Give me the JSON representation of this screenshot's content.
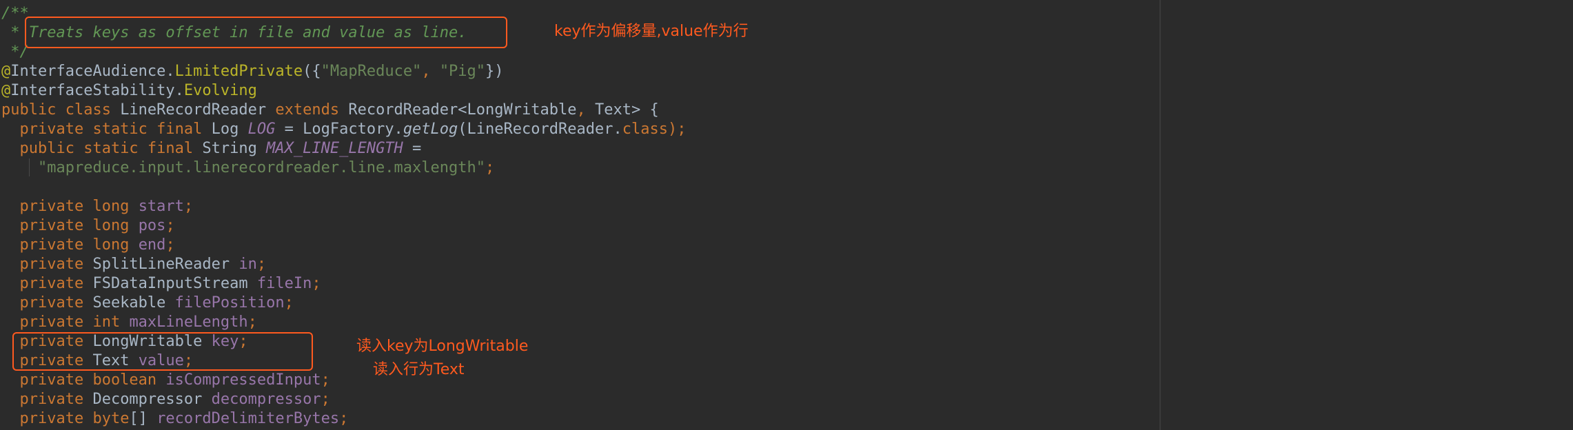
{
  "code_lines": [
    {
      "tokens": [
        {
          "text": "/**",
          "type": "comment"
        }
      ]
    },
    {
      "tokens": [
        {
          "text": " * ",
          "type": "comment"
        },
        {
          "text": "Treats keys as offset in file and value as line.",
          "type": "comment"
        }
      ]
    },
    {
      "tokens": [
        {
          "text": " */",
          "type": "comment"
        }
      ]
    },
    {
      "tokens": [
        {
          "text": "@",
          "type": "ann"
        },
        {
          "text": "InterfaceAudience.",
          "type": "plain"
        },
        {
          "text": "LimitedPrivate",
          "type": "ann"
        },
        {
          "text": "({",
          "type": "plain"
        },
        {
          "text": "\"MapReduce\"",
          "type": "str"
        },
        {
          "text": ", ",
          "type": "kw"
        },
        {
          "text": "\"Pig\"",
          "type": "str"
        },
        {
          "text": "})",
          "type": "plain"
        }
      ]
    },
    {
      "tokens": [
        {
          "text": "@",
          "type": "ann"
        },
        {
          "text": "InterfaceStability.",
          "type": "plain"
        },
        {
          "text": "Evolving",
          "type": "ann"
        }
      ]
    },
    {
      "tokens": [
        {
          "text": "public class ",
          "type": "kw"
        },
        {
          "text": "LineRecordReader ",
          "type": "plain"
        },
        {
          "text": "extends ",
          "type": "kw"
        },
        {
          "text": "RecordReader<LongWritable",
          "type": "plain"
        },
        {
          "text": ", ",
          "type": "kw"
        },
        {
          "text": "Text> {",
          "type": "plain"
        }
      ]
    },
    {
      "tokens": [
        {
          "text": "  private static final ",
          "type": "kw"
        },
        {
          "text": "Log ",
          "type": "plain"
        },
        {
          "text": "LOG",
          "type": "static-field"
        },
        {
          "text": " = LogFactory.",
          "type": "plain"
        },
        {
          "text": "getLog",
          "type": "static-call"
        },
        {
          "text": "(LineRecordReader.",
          "type": "plain"
        },
        {
          "text": "class",
          "type": "kw"
        },
        {
          "text": ");",
          "type": "kw"
        }
      ]
    },
    {
      "tokens": [
        {
          "text": "  public static final ",
          "type": "kw"
        },
        {
          "text": "String ",
          "type": "plain"
        },
        {
          "text": "MAX_LINE_LENGTH",
          "type": "static-field"
        },
        {
          "text": " =",
          "type": "plain"
        }
      ]
    },
    {
      "tokens": [
        {
          "text": "    ",
          "type": "plain"
        },
        {
          "text": "\"mapreduce.input.linerecordreader.line.maxlength\"",
          "type": "str"
        },
        {
          "text": ";",
          "type": "kw"
        }
      ]
    },
    {
      "tokens": [
        {
          "text": "",
          "type": "plain"
        }
      ]
    },
    {
      "tokens": [
        {
          "text": "  private long ",
          "type": "kw"
        },
        {
          "text": "start",
          "type": "field"
        },
        {
          "text": ";",
          "type": "kw"
        }
      ]
    },
    {
      "tokens": [
        {
          "text": "  private long ",
          "type": "kw"
        },
        {
          "text": "pos",
          "type": "field"
        },
        {
          "text": ";",
          "type": "kw"
        }
      ]
    },
    {
      "tokens": [
        {
          "text": "  private long ",
          "type": "kw"
        },
        {
          "text": "end",
          "type": "field"
        },
        {
          "text": ";",
          "type": "kw"
        }
      ]
    },
    {
      "tokens": [
        {
          "text": "  private ",
          "type": "kw"
        },
        {
          "text": "SplitLineReader ",
          "type": "plain"
        },
        {
          "text": "in",
          "type": "field"
        },
        {
          "text": ";",
          "type": "kw"
        }
      ]
    },
    {
      "tokens": [
        {
          "text": "  private ",
          "type": "kw"
        },
        {
          "text": "FSDataInputStream ",
          "type": "plain"
        },
        {
          "text": "fileIn",
          "type": "field"
        },
        {
          "text": ";",
          "type": "kw"
        }
      ]
    },
    {
      "tokens": [
        {
          "text": "  private ",
          "type": "kw"
        },
        {
          "text": "Seekable ",
          "type": "plain"
        },
        {
          "text": "filePosition",
          "type": "field"
        },
        {
          "text": ";",
          "type": "kw"
        }
      ]
    },
    {
      "tokens": [
        {
          "text": "  private int ",
          "type": "kw"
        },
        {
          "text": "maxLineLength",
          "type": "field"
        },
        {
          "text": ";",
          "type": "kw"
        }
      ]
    },
    {
      "tokens": [
        {
          "text": "  private ",
          "type": "kw"
        },
        {
          "text": "LongWritable ",
          "type": "plain"
        },
        {
          "text": "key",
          "type": "field"
        },
        {
          "text": ";",
          "type": "kw"
        }
      ]
    },
    {
      "tokens": [
        {
          "text": "  private ",
          "type": "kw"
        },
        {
          "text": "Text ",
          "type": "plain"
        },
        {
          "text": "value",
          "type": "field"
        },
        {
          "text": ";",
          "type": "kw"
        }
      ]
    },
    {
      "tokens": [
        {
          "text": "  private boolean ",
          "type": "kw"
        },
        {
          "text": "isCompressedInput",
          "type": "field"
        },
        {
          "text": ";",
          "type": "kw"
        }
      ]
    },
    {
      "tokens": [
        {
          "text": "  private ",
          "type": "kw"
        },
        {
          "text": "Decompressor ",
          "type": "plain"
        },
        {
          "text": "decompressor",
          "type": "field"
        },
        {
          "text": ";",
          "type": "kw"
        }
      ]
    },
    {
      "tokens": [
        {
          "text": "  private ",
          "type": "kw"
        },
        {
          "text": "byte",
          "type": "kw"
        },
        {
          "text": "[] ",
          "type": "plain"
        },
        {
          "text": "recordDelimiterBytes",
          "type": "field"
        },
        {
          "text": ";",
          "type": "kw"
        }
      ]
    }
  ],
  "annotations": {
    "note_1": "key作为偏移量,value作为行",
    "note_2": "读入key为LongWritable",
    "note_3": "读入行为Text"
  },
  "colors": {
    "background": "#2b2b2b",
    "keyword": "#cc7832",
    "comment": "#629755",
    "string": "#6a8759",
    "annotation": "#bbb529",
    "field": "#9876aa",
    "text": "#a9b7c6",
    "highlight": "#ff5a1f"
  }
}
